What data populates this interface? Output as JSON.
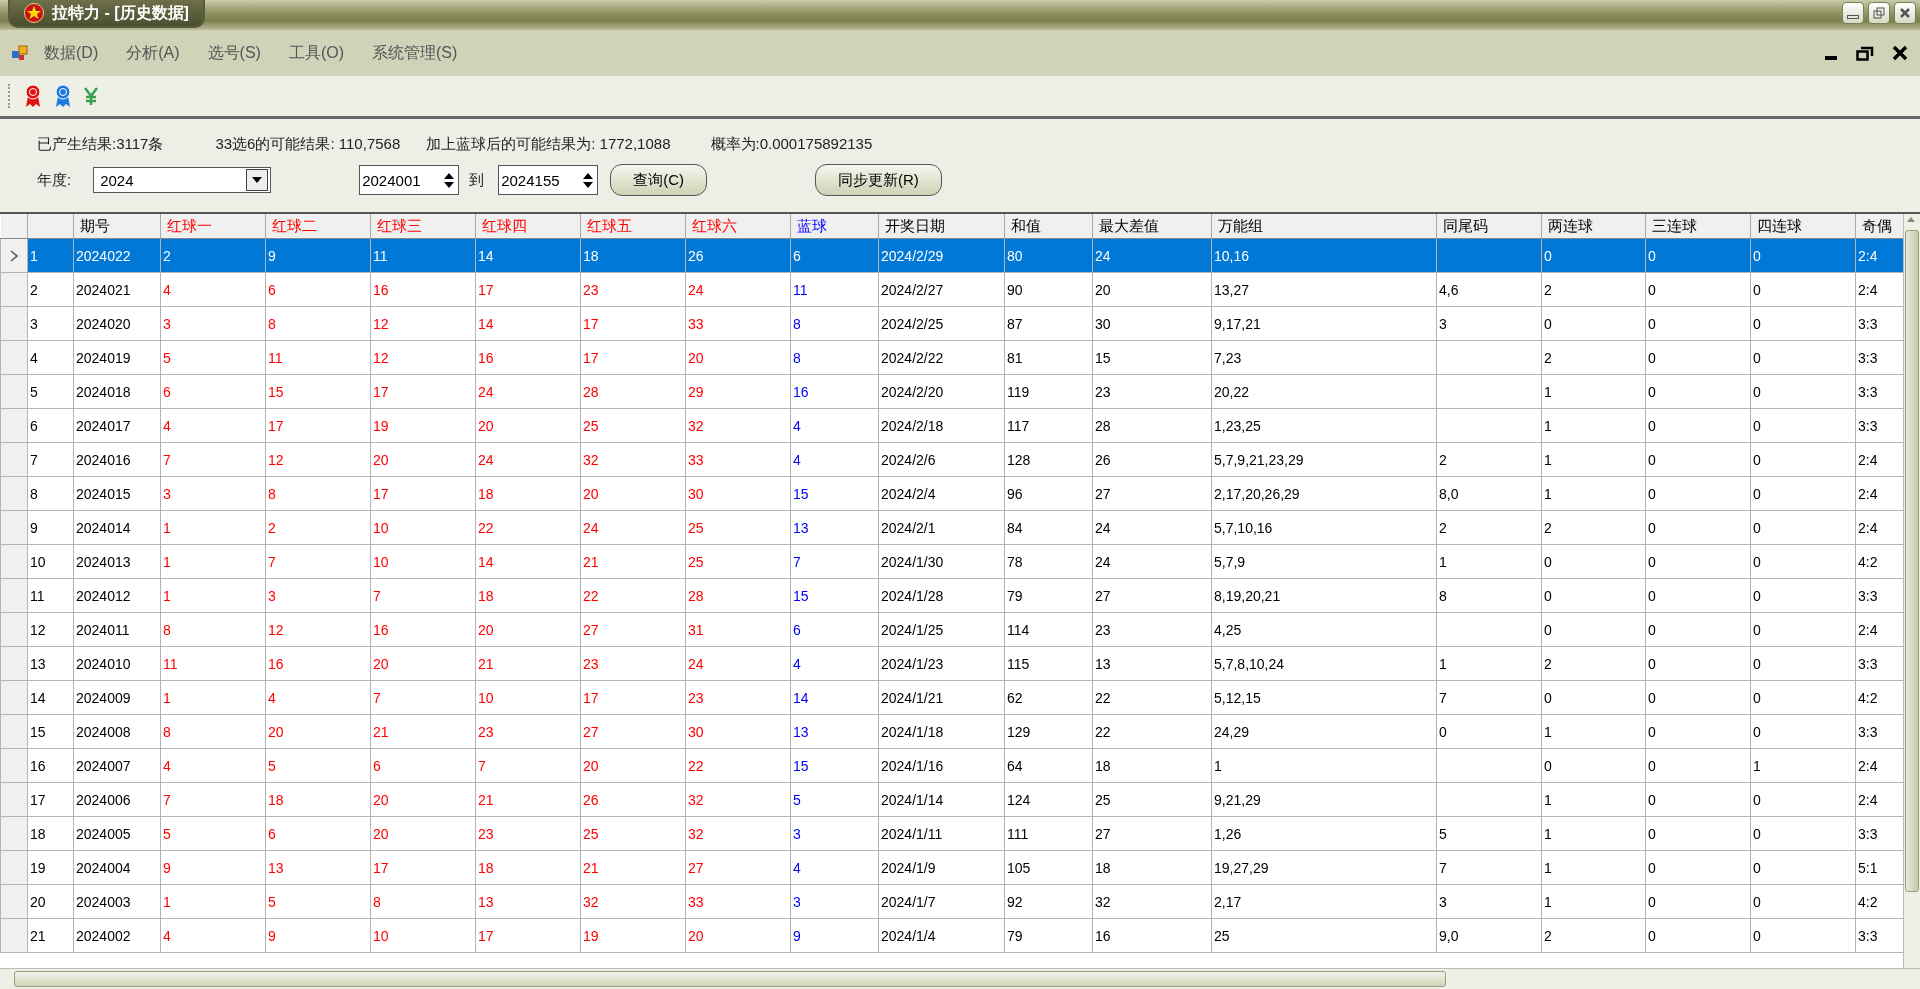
{
  "window": {
    "title": "拉特力 - [历史数据]"
  },
  "menu": [
    "数据(D)",
    "分析(A)",
    "选号(S)",
    "工具(O)",
    "系统管理(S)"
  ],
  "summary": [
    "已产生结果:3117条",
    "33选6的可能结果: 110,7568",
    "加上蓝球后的可能结果为: 1772,1088",
    "概率为:0.000175892135"
  ],
  "filter": {
    "year_label": "年度:",
    "year": "2024",
    "from": "2024001",
    "to_label": "到",
    "to": "2024155",
    "buttons": [
      "查询(C)",
      "同步更新(R)"
    ]
  },
  "table": {
    "columns": [
      {
        "label": "期号",
        "kind": "plain"
      },
      {
        "label": "红球一",
        "kind": "red"
      },
      {
        "label": "红球二",
        "kind": "red"
      },
      {
        "label": "红球三",
        "kind": "red"
      },
      {
        "label": "红球四",
        "kind": "red"
      },
      {
        "label": "红球五",
        "kind": "red"
      },
      {
        "label": "红球六",
        "kind": "red"
      },
      {
        "label": "蓝球",
        "kind": "blue"
      },
      {
        "label": "开奖日期",
        "kind": "plain"
      },
      {
        "label": "和值",
        "kind": "plain"
      },
      {
        "label": "最大差值",
        "kind": "plain"
      },
      {
        "label": "万能组",
        "kind": "plain"
      },
      {
        "label": "同尾码",
        "kind": "plain"
      },
      {
        "label": "两连球",
        "kind": "plain"
      },
      {
        "label": "三连球",
        "kind": "plain"
      },
      {
        "label": "四连球",
        "kind": "plain"
      },
      {
        "label": "奇偶",
        "kind": "plain"
      }
    ],
    "rows": [
      {
        "index": "1",
        "selected": true,
        "cells": [
          "2024022",
          "2",
          "9",
          "11",
          "14",
          "18",
          "26",
          "6",
          "2024/2/29",
          "80",
          "24",
          "10,16",
          null,
          "0",
          "0",
          "0",
          "2:4"
        ]
      },
      {
        "index": "2",
        "selected": false,
        "cells": [
          "2024021",
          "4",
          "6",
          "16",
          "17",
          "23",
          "24",
          "11",
          "2024/2/27",
          "90",
          "20",
          "13,27",
          "4,6",
          "2",
          "0",
          "0",
          "2:4"
        ]
      },
      {
        "index": "3",
        "selected": false,
        "cells": [
          "2024020",
          "3",
          "8",
          "12",
          "14",
          "17",
          "33",
          "8",
          "2024/2/25",
          "87",
          "30",
          "9,17,21",
          "3",
          "0",
          "0",
          "0",
          "3:3"
        ]
      },
      {
        "index": "4",
        "selected": false,
        "cells": [
          "2024019",
          "5",
          "11",
          "12",
          "16",
          "17",
          "20",
          "8",
          "2024/2/22",
          "81",
          "15",
          "7,23",
          null,
          "2",
          "0",
          "0",
          "3:3"
        ]
      },
      {
        "index": "5",
        "selected": false,
        "cells": [
          "2024018",
          "6",
          "15",
          "17",
          "24",
          "28",
          "29",
          "16",
          "2024/2/20",
          "119",
          "23",
          "20,22",
          null,
          "1",
          "0",
          "0",
          "3:3"
        ]
      },
      {
        "index": "6",
        "selected": false,
        "cells": [
          "2024017",
          "4",
          "17",
          "19",
          "20",
          "25",
          "32",
          "4",
          "2024/2/18",
          "117",
          "28",
          "1,23,25",
          null,
          "1",
          "0",
          "0",
          "3:3"
        ]
      },
      {
        "index": "7",
        "selected": false,
        "cells": [
          "2024016",
          "7",
          "12",
          "20",
          "24",
          "32",
          "33",
          "4",
          "2024/2/6",
          "128",
          "26",
          "5,7,9,21,23,29",
          "2",
          "1",
          "0",
          "0",
          "2:4"
        ]
      },
      {
        "index": "8",
        "selected": false,
        "cells": [
          "2024015",
          "3",
          "8",
          "17",
          "18",
          "20",
          "30",
          "15",
          "2024/2/4",
          "96",
          "27",
          "2,17,20,26,29",
          "8,0",
          "1",
          "0",
          "0",
          "2:4"
        ]
      },
      {
        "index": "9",
        "selected": false,
        "cells": [
          "2024014",
          "1",
          "2",
          "10",
          "22",
          "24",
          "25",
          "13",
          "2024/2/1",
          "84",
          "24",
          "5,7,10,16",
          "2",
          "2",
          "0",
          "0",
          "2:4"
        ]
      },
      {
        "index": "10",
        "selected": false,
        "cells": [
          "2024013",
          "1",
          "7",
          "10",
          "14",
          "21",
          "25",
          "7",
          "2024/1/30",
          "78",
          "24",
          "5,7,9",
          "1",
          "0",
          "0",
          "0",
          "4:2"
        ]
      },
      {
        "index": "11",
        "selected": false,
        "cells": [
          "2024012",
          "1",
          "3",
          "7",
          "18",
          "22",
          "28",
          "15",
          "2024/1/28",
          "79",
          "27",
          "8,19,20,21",
          "8",
          "0",
          "0",
          "0",
          "3:3"
        ]
      },
      {
        "index": "12",
        "selected": false,
        "cells": [
          "2024011",
          "8",
          "12",
          "16",
          "20",
          "27",
          "31",
          "6",
          "2024/1/25",
          "114",
          "23",
          "4,25",
          null,
          "0",
          "0",
          "0",
          "2:4"
        ]
      },
      {
        "index": "13",
        "selected": false,
        "cells": [
          "2024010",
          "11",
          "16",
          "20",
          "21",
          "23",
          "24",
          "4",
          "2024/1/23",
          "115",
          "13",
          "5,7,8,10,24",
          "1",
          "2",
          "0",
          "0",
          "3:3"
        ]
      },
      {
        "index": "14",
        "selected": false,
        "cells": [
          "2024009",
          "1",
          "4",
          "7",
          "10",
          "17",
          "23",
          "14",
          "2024/1/21",
          "62",
          "22",
          "5,12,15",
          "7",
          "0",
          "0",
          "0",
          "4:2"
        ]
      },
      {
        "index": "15",
        "selected": false,
        "cells": [
          "2024008",
          "8",
          "20",
          "21",
          "23",
          "27",
          "30",
          "13",
          "2024/1/18",
          "129",
          "22",
          "24,29",
          "0",
          "1",
          "0",
          "0",
          "3:3"
        ]
      },
      {
        "index": "16",
        "selected": false,
        "cells": [
          "2024007",
          "4",
          "5",
          "6",
          "7",
          "20",
          "22",
          "15",
          "2024/1/16",
          "64",
          "18",
          "1",
          null,
          "0",
          "0",
          "1",
          "2:4"
        ]
      },
      {
        "index": "17",
        "selected": false,
        "cells": [
          "2024006",
          "7",
          "18",
          "20",
          "21",
          "26",
          "32",
          "5",
          "2024/1/14",
          "124",
          "25",
          "9,21,29",
          null,
          "1",
          "0",
          "0",
          "2:4"
        ]
      },
      {
        "index": "18",
        "selected": false,
        "cells": [
          "2024005",
          "5",
          "6",
          "20",
          "23",
          "25",
          "32",
          "3",
          "2024/1/11",
          "111",
          "27",
          "1,26",
          "5",
          "1",
          "0",
          "0",
          "3:3"
        ]
      },
      {
        "index": "19",
        "selected": false,
        "cells": [
          "2024004",
          "9",
          "13",
          "17",
          "18",
          "21",
          "27",
          "4",
          "2024/1/9",
          "105",
          "18",
          "19,27,29",
          "7",
          "1",
          "0",
          "0",
          "5:1"
        ]
      },
      {
        "index": "20",
        "selected": false,
        "cells": [
          "2024003",
          "1",
          "5",
          "8",
          "13",
          "32",
          "33",
          "3",
          "2024/1/7",
          "92",
          "32",
          "2,17",
          "3",
          "1",
          "0",
          "0",
          "4:2"
        ]
      },
      {
        "index": "21",
        "selected": false,
        "cells": [
          "2024002",
          "4",
          "9",
          "10",
          "17",
          "19",
          "20",
          "9",
          "2024/1/4",
          "79",
          "16",
          "25",
          "9,0",
          "2",
          "0",
          "0",
          "3:3"
        ]
      }
    ]
  }
}
